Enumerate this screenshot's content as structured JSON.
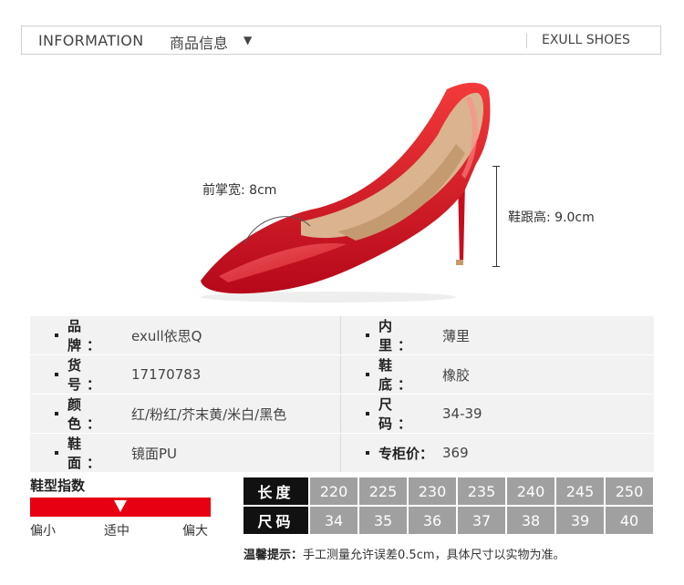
{
  "header": {
    "title_en": "INFORMATION",
    "title_cn": "商品信息",
    "arrow": "▼",
    "brand": "EXULL SHOES"
  },
  "dimensions": {
    "forefoot": "前掌宽: 8cm",
    "heel": "鞋跟高: 9.0cm"
  },
  "specs": [
    [
      {
        "k": "品 牌：",
        "v": "exull依思Q"
      },
      {
        "k": "内 里：",
        "v": "薄里"
      }
    ],
    [
      {
        "k": "货 号：",
        "v": "17170783"
      },
      {
        "k": "鞋 底：",
        "v": "橡胶"
      }
    ],
    [
      {
        "k": "颜 色：",
        "v": "红/粉红/芥末黄/米白/黑色"
      },
      {
        "k": "尺 码：",
        "v": "34-39"
      }
    ],
    [
      {
        "k": "鞋 面：",
        "v": "镜面PU"
      },
      {
        "k": "专柜价：",
        "v": "369"
      }
    ]
  ],
  "fit": {
    "title": "鞋型指数",
    "small": "偏小",
    "normal": "适中",
    "large": "偏大",
    "level": 0.5,
    "color": "#e60012"
  },
  "sizes": {
    "length_label": "长度",
    "size_label": "尺码",
    "lengths": [
      "220",
      "225",
      "230",
      "235",
      "240",
      "245",
      "250"
    ],
    "codes": [
      "34",
      "35",
      "36",
      "37",
      "38",
      "39",
      "40"
    ]
  },
  "note": {
    "label": "温馨提示：",
    "text": "手工测量允许误差0.5cm，具体尺寸以实物为准。"
  }
}
